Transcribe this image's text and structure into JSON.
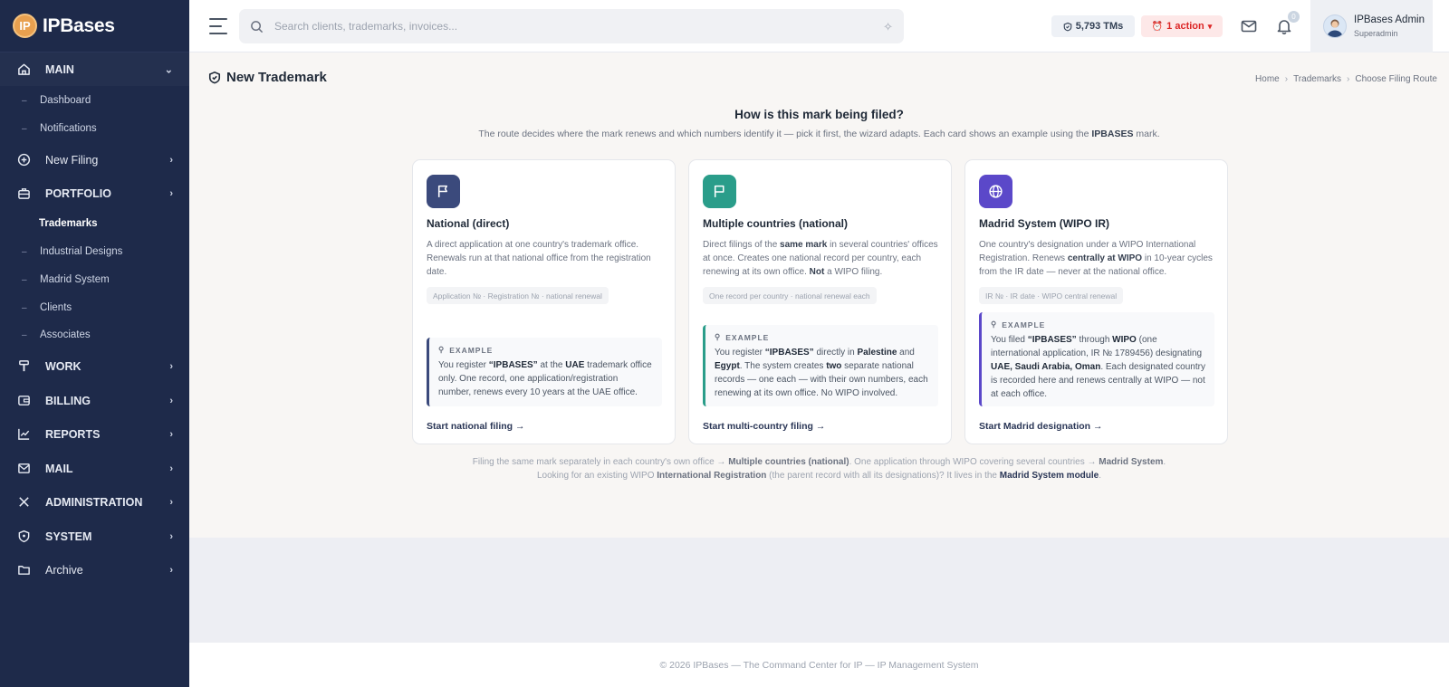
{
  "app": {
    "logo_mark": "IP",
    "name": "IPBases"
  },
  "sidebar": {
    "main": "MAIN",
    "dashboard": "Dashboard",
    "notifications": "Notifications",
    "new_filing": "New Filing",
    "portfolio": "PORTFOLIO",
    "trademarks": "Trademarks",
    "industrial_designs": "Industrial Designs",
    "madrid_system": "Madrid System",
    "clients": "Clients",
    "associates": "Associates",
    "work": "WORK",
    "billing": "BILLING",
    "reports": "REPORTS",
    "mail": "MAIL",
    "administration": "ADMINISTRATION",
    "system": "SYSTEM",
    "archive": "Archive",
    "dash_glyph": "–"
  },
  "topbar": {
    "search_placeholder": "Search clients, trademarks, invoices...",
    "tms_count": "5,793 TMs",
    "action": "1 action",
    "bell_count": "0",
    "user_name": "IPBases Admin",
    "user_role": "Superadmin"
  },
  "page": {
    "title": "New Trademark",
    "breadcrumb": {
      "home": "Home",
      "trademarks": "Trademarks",
      "current": "Choose Filing Route",
      "sep": "›"
    }
  },
  "question": {
    "title": "How is this mark being filed?",
    "subtitle_pre": "The route decides where the mark renews and which numbers identify it — pick it first, the wizard adapts. Each card shows an example using the ",
    "subtitle_mark": "IPBASES",
    "subtitle_post": " mark."
  },
  "cards": [
    {
      "title": "National (direct)",
      "desc": "A direct application at one country's trademark office. Renewals run at that national office from the registration date.",
      "tag": "Application № · Registration № · national renewal",
      "example_label": "EXAMPLE",
      "example_1": "You register ",
      "example_2": "“IPBASES”",
      "example_3": " at the ",
      "example_4": "UAE",
      "example_5": " trademark office only. One record, one application/registration number, renews every 10 years at the UAE office.",
      "link": "Start national filing →",
      "color": "#3b4a7c"
    },
    {
      "title": "Multiple countries (national)",
      "desc_1": "Direct filings of the ",
      "desc_2": "same mark",
      "desc_3": " in several countries' offices at once. Creates one national record per country, each renewing at its own office. ",
      "desc_4": "Not",
      "desc_5": " a WIPO filing.",
      "tag": "One record per country · national renewal each",
      "example_label": "EXAMPLE",
      "example_1": "You register ",
      "example_2": "“IPBASES”",
      "example_3": " directly in ",
      "example_4": "Palestine",
      "example_5": " and ",
      "example_6": "Egypt",
      "example_7": ". The system creates ",
      "example_8": "two",
      "example_9": " separate national records — one each — with their own numbers, each renewing at its own office. No WIPO involved.",
      "link": "Start multi-country filing →",
      "color": "#2a9d8a"
    },
    {
      "title": "Madrid System (WIPO IR)",
      "desc_1": "One country's designation under a WIPO International Registration. Renews ",
      "desc_2": "centrally at WIPO",
      "desc_3": " in 10-year cycles from the IR date — never at the national office.",
      "tag": "IR № · IR date · WIPO central renewal",
      "example_label": "EXAMPLE",
      "example_1": "You filed ",
      "example_2": "“IPBASES”",
      "example_3": " through ",
      "example_4": "WIPO",
      "example_5": " (one international application, IR № 1789456) designating ",
      "example_6": "UAE, Saudi Arabia, Oman",
      "example_7": ". Each designated country is recorded here and renews centrally at WIPO — not at each office.",
      "link": "Start Madrid designation →",
      "color": "#5b48c9"
    }
  ],
  "note": {
    "line1_a": "Filing the same mark separately in each country's own office → ",
    "line1_b": "Multiple countries (national)",
    "line1_c": ". One application through WIPO covering several countries → ",
    "line1_d": "Madrid System",
    "line1_e": ".",
    "line2_a": "Looking for an existing WIPO ",
    "line2_b": "International Registration",
    "line2_c": " (the parent record with all its designations)? It lives in the ",
    "line2_d": "Madrid System module",
    "line2_e": "."
  },
  "footer": "© 2026 IPBases — The Command Center for IP — IP Management System"
}
